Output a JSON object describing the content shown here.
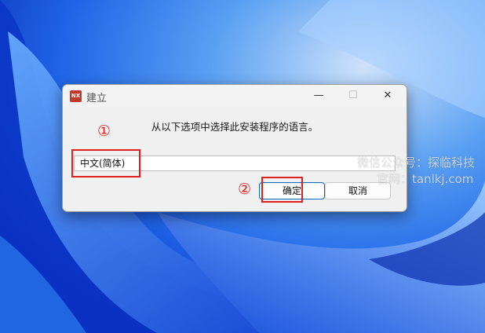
{
  "dialog": {
    "title": "建立",
    "app_icon_text": "NX",
    "minimize_glyph": "—",
    "maximize_glyph": "☐",
    "close_glyph": "✕",
    "prompt": "从以下选项中选择此安装程序的语言。",
    "language_value": "中文(简体)",
    "ok_label": "确定",
    "cancel_label": "取消"
  },
  "annotations": {
    "step1": "①",
    "step2": "②",
    "highlight_color": "#e02020"
  },
  "watermark": {
    "line1": "微信公众号：探临科技",
    "line2": "官网：tanlkj.com"
  },
  "colors": {
    "accent": "#0067c0",
    "desktop_base": "#0b3fd6"
  }
}
